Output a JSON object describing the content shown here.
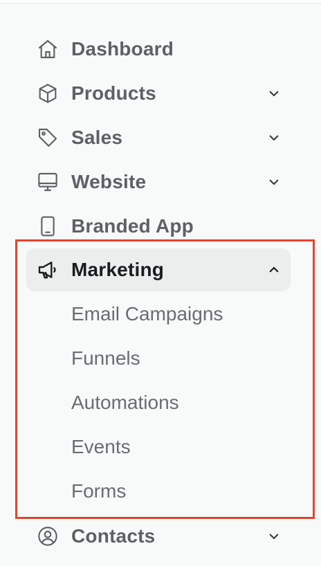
{
  "nav": {
    "items": [
      {
        "label": "Dashboard",
        "icon": "home-icon"
      },
      {
        "label": "Products",
        "icon": "box-icon"
      },
      {
        "label": "Sales",
        "icon": "tag-icon"
      },
      {
        "label": "Website",
        "icon": "monitor-icon"
      },
      {
        "label": "Branded App",
        "icon": "smartphone-icon"
      },
      {
        "label": "Marketing",
        "icon": "megaphone-icon"
      },
      {
        "label": "Contacts",
        "icon": "user-circle-icon"
      }
    ],
    "marketing_subitems": [
      {
        "label": "Email Campaigns"
      },
      {
        "label": "Funnels"
      },
      {
        "label": "Automations"
      },
      {
        "label": "Events"
      },
      {
        "label": "Forms"
      }
    ],
    "active_item": "Marketing"
  },
  "colors": {
    "background": "#f8f9f9",
    "active_background": "#eceded",
    "highlight_border": "#e0452e",
    "text_muted": "#5e6066",
    "text_active": "#1b1c1f"
  }
}
